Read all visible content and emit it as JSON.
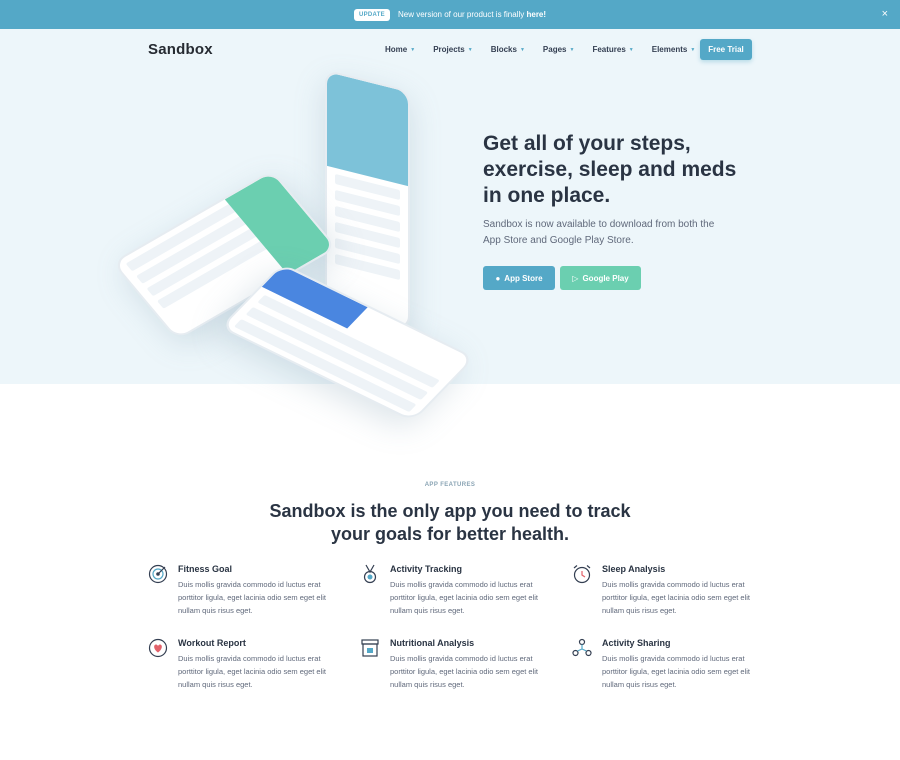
{
  "topbar": {
    "badge": "UPDATE",
    "message": "New version of our product is finally ",
    "link": "here!",
    "close": "×"
  },
  "header": {
    "logo": "Sandbox",
    "nav": [
      "Home",
      "Projects",
      "Blocks",
      "Pages",
      "Features",
      "Elements"
    ],
    "cta": "Free Trial"
  },
  "hero": {
    "title": "Get all of your steps, exercise, sleep and meds in one place.",
    "subtitle": "Sandbox is now available to download from both the App Store and Google Play Store.",
    "btn_app": "App Store",
    "btn_play": "Google Play"
  },
  "features": {
    "eyebrow": "APP FEATURES",
    "title": "Sandbox is the only app you need to track your goals for better health.",
    "items": [
      {
        "icon": "target-icon",
        "title": "Fitness Goal",
        "desc": "Duis mollis gravida commodo id luctus erat porttitor ligula, eget lacinia odio sem eget elit nullam quis risus eget."
      },
      {
        "icon": "medal-icon",
        "title": "Activity Tracking",
        "desc": "Duis mollis gravida commodo id luctus erat porttitor ligula, eget lacinia odio sem eget elit nullam quis risus eget."
      },
      {
        "icon": "alarm-clock-icon",
        "title": "Sleep Analysis",
        "desc": "Duis mollis gravida commodo id luctus erat porttitor ligula, eget lacinia odio sem eget elit nullam quis risus eget."
      },
      {
        "icon": "heart-report-icon",
        "title": "Workout Report",
        "desc": "Duis mollis gravida commodo id luctus erat porttitor ligula, eget lacinia odio sem eget elit nullam quis risus eget."
      },
      {
        "icon": "store-icon",
        "title": "Nutritional Analysis",
        "desc": "Duis mollis gravida commodo id luctus erat porttitor ligula, eget lacinia odio sem eget elit nullam quis risus eget."
      },
      {
        "icon": "share-network-icon",
        "title": "Activity Sharing",
        "desc": "Duis mollis gravida commodo id luctus erat porttitor ligula, eget lacinia odio sem eget elit nullam quis risus eget."
      }
    ]
  },
  "colors": {
    "accent": "#54a8c7",
    "green": "#6bcfb0",
    "hero_bg": "#edf6fa",
    "heading": "#2a3443"
  }
}
